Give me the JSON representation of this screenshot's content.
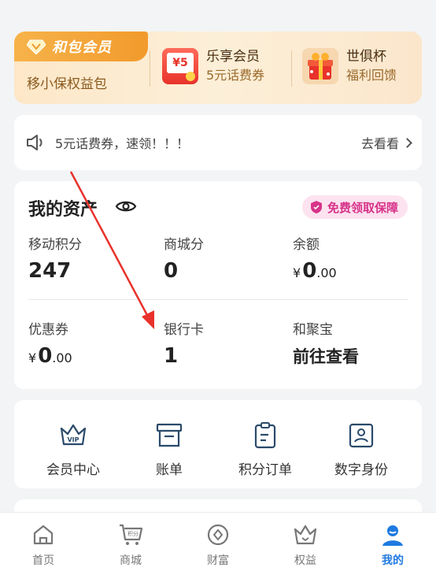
{
  "member_card": {
    "badge": "和包会员",
    "subtitle": "移小保权益包",
    "promo1": {
      "icon_text": "¥5",
      "title": "乐享会员",
      "subtitle": "5元话费券"
    },
    "promo2": {
      "title": "世俱杯",
      "subtitle": "福利回馈"
    }
  },
  "notice": {
    "text": "5元话费券，速领！！！",
    "link": "去看看"
  },
  "assets": {
    "title": "我的资产",
    "free_pill": "免费领取保障",
    "items": [
      {
        "label": "移动积分",
        "value": "247"
      },
      {
        "label": "商城分",
        "value": "0"
      },
      {
        "label": "余额",
        "currency": "¥",
        "int": "0",
        "dec": ".00"
      },
      {
        "label": "优惠券",
        "currency": "¥",
        "int": "0",
        "dec": ".00"
      },
      {
        "label": "银行卡",
        "value": "1"
      },
      {
        "label": "和聚宝",
        "value": "前往查看"
      }
    ]
  },
  "quick": [
    {
      "label": "会员中心",
      "icon": "vip-crown-icon"
    },
    {
      "label": "账单",
      "icon": "bill-box-icon"
    },
    {
      "label": "积分订单",
      "icon": "clipboard-icon"
    },
    {
      "label": "数字身份",
      "icon": "id-card-icon"
    }
  ],
  "tabs": [
    {
      "label": "首页",
      "icon": "home-icon"
    },
    {
      "label": "商城",
      "icon": "cart-icon",
      "icon_text": "积分"
    },
    {
      "label": "财富",
      "icon": "wealth-icon"
    },
    {
      "label": "权益",
      "icon": "crown-icon"
    },
    {
      "label": "我的",
      "icon": "profile-icon",
      "active": true
    }
  ],
  "colors": {
    "accent": "#1f7ae0",
    "annotation_arrow": "#e8322b",
    "pill_text": "#d6338a"
  }
}
